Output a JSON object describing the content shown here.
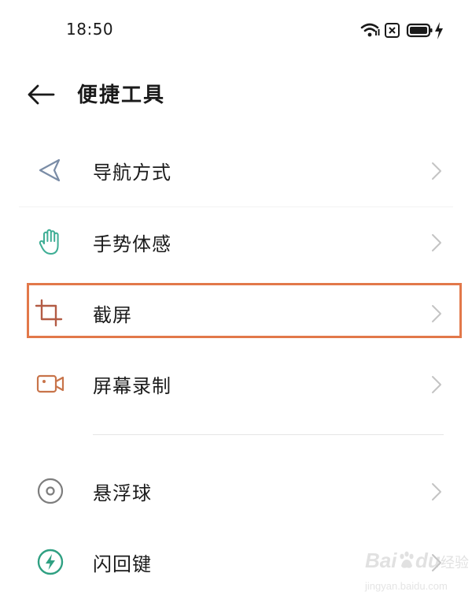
{
  "status_bar": {
    "time": "18:50",
    "icons": [
      "wifi-icon",
      "sim-off-icon",
      "battery-icon",
      "charging-icon"
    ]
  },
  "header": {
    "back_icon": "arrow-left-icon",
    "title": "便捷工具"
  },
  "menu": {
    "items": [
      {
        "label": "导航方式",
        "icon": "navigation-triangle-icon",
        "icon_color": "#7a8ca6"
      },
      {
        "label": "手势体感",
        "icon": "hand-gesture-icon",
        "icon_color": "#3fae95"
      },
      {
        "label": "截屏",
        "icon": "crop-icon",
        "icon_color": "#b35c45",
        "highlighted": true
      },
      {
        "label": "屏幕录制",
        "icon": "video-camera-icon",
        "icon_color": "#c8744a"
      },
      {
        "label": "悬浮球",
        "icon": "floating-ball-icon",
        "icon_color": "#7d7d7d"
      },
      {
        "label": "闪回键",
        "icon": "flashback-bolt-icon",
        "icon_color": "#2fa082"
      }
    ]
  },
  "colors": {
    "highlight_border": "#e2784a",
    "chevron": "#c4c4c4",
    "divider": "#e6e6e6"
  },
  "watermark": {
    "brand_left": "Bai",
    "brand_right": "du",
    "product": "经验",
    "url": "jingyan.baidu.com"
  }
}
